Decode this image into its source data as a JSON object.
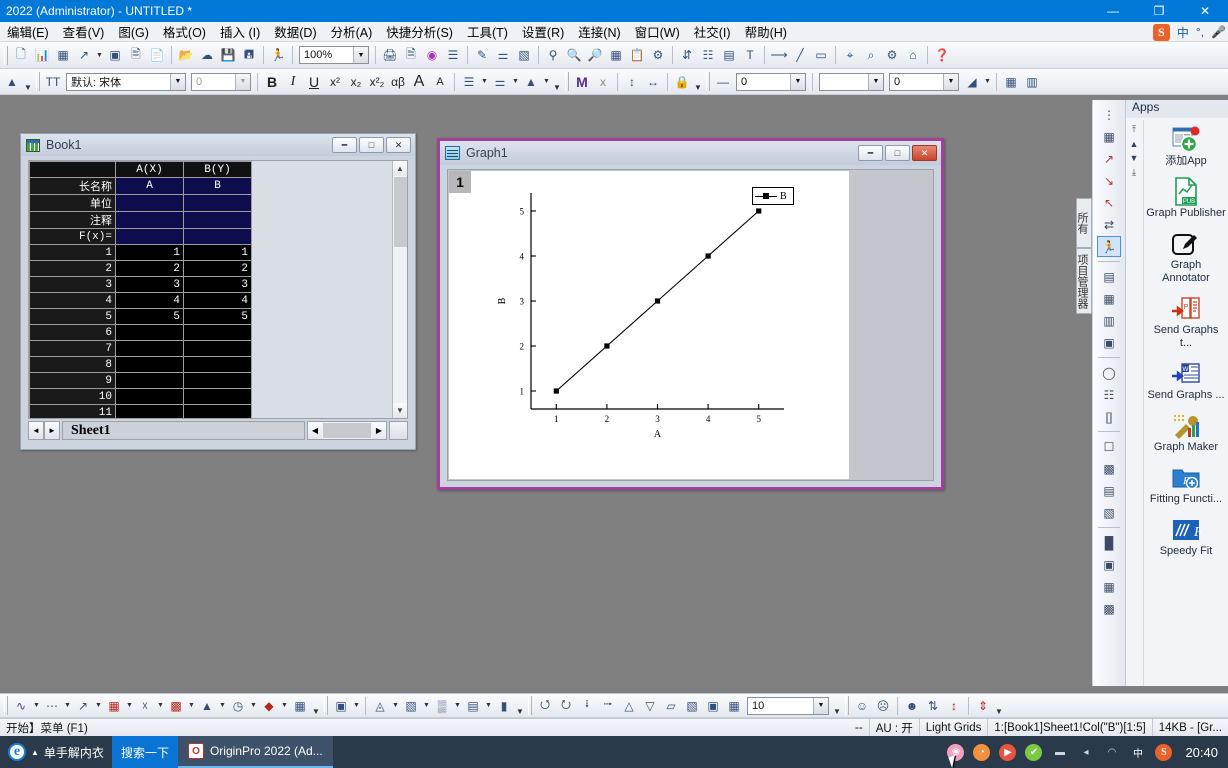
{
  "window": {
    "title": "2022 (Administrator) - UNTITLED *",
    "minimize": "—",
    "restore": "❐",
    "close": "✕"
  },
  "menubar": {
    "items": [
      {
        "label": "编辑(E)"
      },
      {
        "label": "查看(V)"
      },
      {
        "label": "图(G)"
      },
      {
        "label": "格式(O)"
      },
      {
        "label": "插入 (I)"
      },
      {
        "label": "数据(D)"
      },
      {
        "label": "分析(A)"
      },
      {
        "label": "快捷分析(S)"
      },
      {
        "label": "工具(T)"
      },
      {
        "label": "设置(R)"
      },
      {
        "label": "连接(N)"
      },
      {
        "label": "窗口(W)"
      },
      {
        "label": "社交(I)"
      },
      {
        "label": "帮助(H)"
      }
    ],
    "ime": {
      "sogou": "S",
      "lang": "中",
      "punct": "°,",
      "mic": "⬤"
    }
  },
  "toolbar_standard": {
    "zoom_value": "100%",
    "icons": [
      "new-project-icon",
      "new-workbook-icon",
      "new-graph-icon",
      "new-matrix-icon",
      "new-function-icon",
      "new-layout-icon",
      "new-notes-icon",
      "new-excel-icon",
      "open-icon",
      "open-cloud-icon",
      "save-project-icon",
      "save-template-icon",
      "run-script-icon"
    ],
    "icons2": [
      "print-icon",
      "print-preview-icon",
      "import-wizard-icon",
      "import-multiple-icon",
      "copy-page-icon",
      "layer-contents-icon",
      "merge-graph-icon",
      "extract-graph-icon",
      "zoom-in-icon",
      "zoom-out-icon",
      "data-display-icon",
      "results-log-icon",
      "project-explorer-icon",
      "rescale-icon"
    ]
  },
  "toolbar_format": {
    "font_name": "默认: 宋体",
    "font_size": "0",
    "bold": "B",
    "italic": "I",
    "underline": "U",
    "superscript": "x²",
    "subscript": "x₂",
    "supsub": "x²₂",
    "greek": "αβ",
    "increase_font": "A",
    "decrease_font": "A",
    "align_icon": "align-left-icon",
    "pattern_icon": "pattern-icon",
    "color_icon": "font-color-icon",
    "m_icon": "M",
    "x_icon": "x-cancel-icon"
  },
  "workbook": {
    "title": "Book1",
    "columns": [
      "A(X)",
      "B(Y)"
    ],
    "header_rows": [
      {
        "label": "长名称",
        "a": "A",
        "b": "B"
      },
      {
        "label": "单位",
        "a": "",
        "b": ""
      },
      {
        "label": "注释",
        "a": "",
        "b": ""
      },
      {
        "label": "F(x)=",
        "a": "",
        "b": ""
      }
    ],
    "data_rows": [
      {
        "n": "1",
        "a": "1",
        "b": "1"
      },
      {
        "n": "2",
        "a": "2",
        "b": "2"
      },
      {
        "n": "3",
        "a": "3",
        "b": "3"
      },
      {
        "n": "4",
        "a": "4",
        "b": "4"
      },
      {
        "n": "5",
        "a": "5",
        "b": "5"
      },
      {
        "n": "6",
        "a": "",
        "b": ""
      },
      {
        "n": "7",
        "a": "",
        "b": ""
      },
      {
        "n": "8",
        "a": "",
        "b": ""
      },
      {
        "n": "9",
        "a": "",
        "b": ""
      },
      {
        "n": "10",
        "a": "",
        "b": ""
      },
      {
        "n": "11",
        "a": "",
        "b": ""
      }
    ],
    "sheet_tab": "Sheet1",
    "nav_prev": "◄",
    "nav_next": "►"
  },
  "graph": {
    "title": "Graph1",
    "layer_number": "1",
    "legend_label": "B"
  },
  "chart_data": {
    "type": "line",
    "title": "",
    "xlabel": "A",
    "ylabel": "B",
    "x": [
      1,
      2,
      3,
      4,
      5
    ],
    "series": [
      {
        "name": "B",
        "values": [
          1,
          2,
          3,
          4,
          5
        ],
        "marker": "square",
        "color": "#000000"
      }
    ],
    "xlim": [
      0.5,
      5.5
    ],
    "ylim": [
      0.6,
      5.4
    ],
    "xticks": [
      1,
      2,
      3,
      4,
      5
    ],
    "yticks": [
      1,
      2,
      3,
      4,
      5
    ],
    "grid": false,
    "legend_position": "top-right"
  },
  "apps": {
    "title": "Apps",
    "items": [
      {
        "label": "添加App",
        "icon": "add-app-icon",
        "glyph": "➕"
      },
      {
        "label": "Graph Publisher",
        "icon": "graph-publisher-icon",
        "glyph": "📄"
      },
      {
        "label": "Graph Annotator",
        "icon": "graph-annotator-icon",
        "glyph": "✎"
      },
      {
        "label": "Send Graphs t...",
        "icon": "send-graphs-to-powerpoint-icon",
        "glyph": "📑"
      },
      {
        "label": "Send Graphs ...",
        "icon": "send-graphs-to-word-icon",
        "glyph": "📃"
      },
      {
        "label": "Graph Maker",
        "icon": "graph-maker-icon",
        "glyph": "🔧"
      },
      {
        "label": "Fitting Functi...",
        "icon": "fitting-function-icon",
        "glyph": "📁"
      },
      {
        "label": "Speedy Fit",
        "icon": "speedy-fit-icon",
        "glyph": "ƒ"
      }
    ],
    "scroll_top": "⤒",
    "scroll_up": "▲",
    "scroll_down": "▼",
    "scroll_bottom": "⤓"
  },
  "side_tabs": [
    {
      "label": "所有"
    },
    {
      "label": "项目管理器"
    }
  ],
  "bottom_toolbar": {
    "size_value": "10",
    "icons": [
      "line-plot-icon",
      "scatter-plot-icon",
      "line-symbol-icon",
      "column-plot-icon",
      "area-plot-icon",
      "bar-3d-icon",
      "floating-bar-icon",
      "pie-chart-icon",
      "box-chart-icon",
      "3d-scatter-icon",
      "3d-surface-icon",
      "3d-wire-icon",
      "3d-bar-icon",
      "contour-icon",
      "image-plot-icon",
      "ternary-icon"
    ]
  },
  "statusbar": {
    "hint": "开始】菜单 (F1)",
    "dash": "--",
    "au": "AU : 开",
    "theme": "Light Grids",
    "selection": "1:[Book1]Sheet1!Col(\"B\")[1:5]",
    "size": "14KB - [Gr..."
  },
  "taskbar": {
    "ie_label": "单手解内衣",
    "search_button": "搜索一下",
    "task_label": "OriginPro 2022 (Ad...",
    "task_icon_letter": "O",
    "clock": "20:40",
    "tray": [
      {
        "name": "tray-flower-icon",
        "glyph": "❀",
        "color": "#f2a0c0"
      },
      {
        "name": "tray-browser-icon",
        "glyph": "◔",
        "color": "#f2913d"
      },
      {
        "name": "tray-video-icon",
        "glyph": "▶",
        "color": "#e8543f"
      },
      {
        "name": "tray-shield-icon",
        "glyph": "✔",
        "color": "#7ac943"
      },
      {
        "name": "tray-battery-icon",
        "glyph": "▬",
        "color": "#cfd6de"
      },
      {
        "name": "tray-volume-icon",
        "glyph": "◂",
        "color": "#cfd6de"
      },
      {
        "name": "tray-network-icon",
        "glyph": "◠",
        "color": "#cfd6de"
      },
      {
        "name": "tray-ime-icon",
        "glyph": "中",
        "color": "#ffffff"
      },
      {
        "name": "tray-sogou-icon",
        "glyph": "S",
        "color": "#e8622a"
      }
    ]
  }
}
